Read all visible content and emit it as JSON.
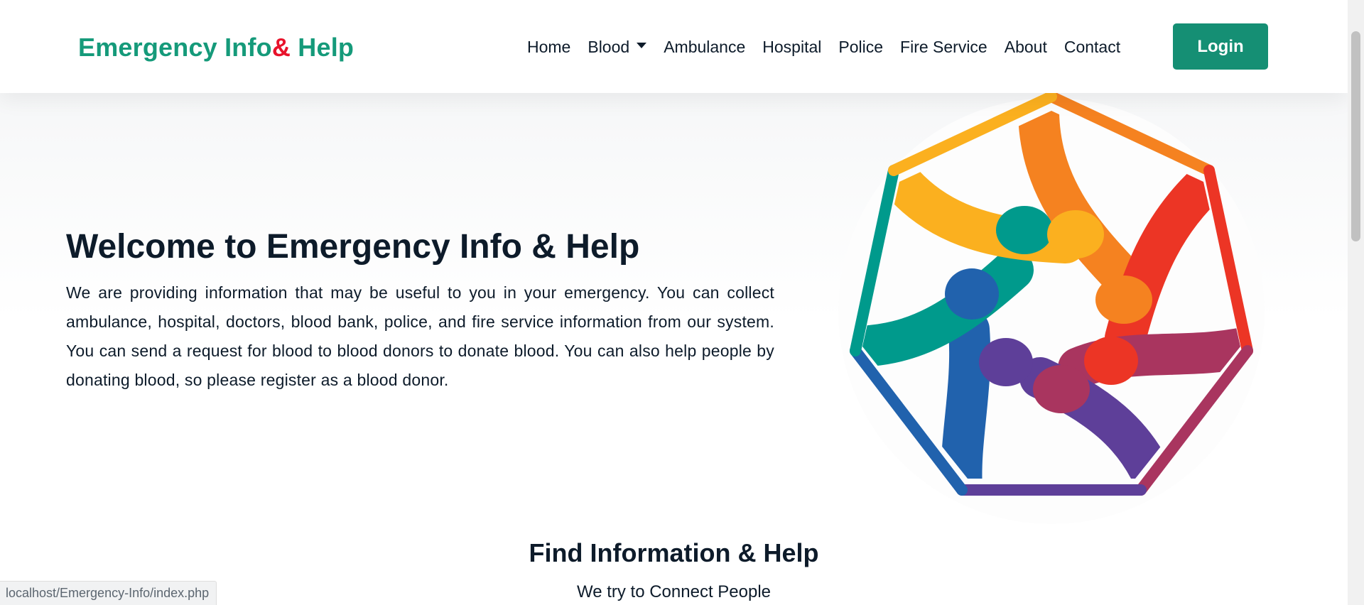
{
  "brand": {
    "part1": "Emergency Info",
    "amp": "&",
    "part2": " Help"
  },
  "nav": {
    "home": "Home",
    "blood": "Blood",
    "ambulance": "Ambulance",
    "hospital": "Hospital",
    "police": "Police",
    "fire_service": "Fire Service",
    "about": "About",
    "contact": "Contact",
    "login": "Login"
  },
  "hero": {
    "title": "Welcome to Emergency Info & Help",
    "text": "We are providing information that may be useful to you in your emergency. You can collect ambulance, hospital, doctors, blood bank, police, and fire service information from our system. You can send a request for blood to blood donors to donate blood. You can also help people by donating blood, so please register as a blood donor."
  },
  "section": {
    "title": "Find Information & Help",
    "subtitle": "We try to Connect People"
  },
  "status_url": "localhost/Emergency-Info/index.php",
  "colors": {
    "brand": "#159a7a",
    "amp": "#e8132b",
    "login_bg": "#158f74",
    "text": "#0d1b2a",
    "hands": [
      "#f58220",
      "#ec3525",
      "#a9355f",
      "#5e3f99",
      "#2162ad",
      "#009a8c",
      "#fbb01f"
    ]
  },
  "icons": {
    "dropdown": "caret-down-icon",
    "hero_image": "connected-hands-illustration"
  }
}
